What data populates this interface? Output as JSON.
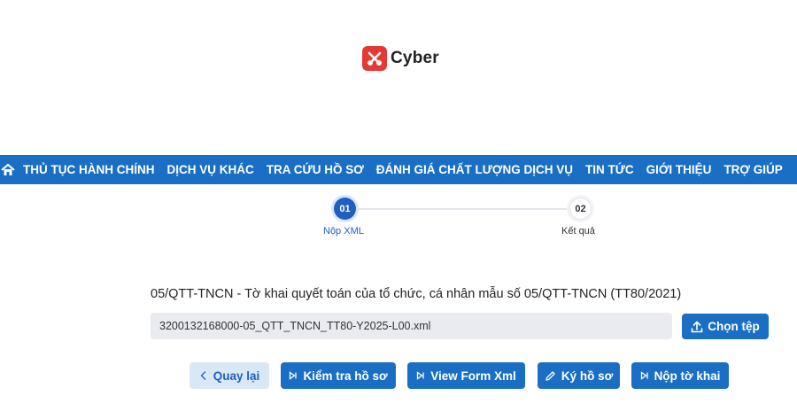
{
  "brand": {
    "name": "Cyber",
    "mark_color": "#e53935"
  },
  "navbar": {
    "home_icon": "home-icon",
    "items": [
      "THỦ TỤC HÀNH CHÍNH",
      "DỊCH VỤ KHÁC",
      "TRA CỨU HỒ SƠ",
      "ĐÁNH GIÁ CHẤT LƯỢNG DỊCH VỤ",
      "TIN TỨC",
      "GIỚI THIỆU",
      "TRỢ GIÚP"
    ],
    "bg_color": "#1a6fc4"
  },
  "stepper": {
    "steps": [
      {
        "number": "01",
        "label": "Nộp XML",
        "state": "active"
      },
      {
        "number": "02",
        "label": "Kết quả",
        "state": "pending"
      }
    ]
  },
  "form": {
    "title": "05/QTT-TNCN - Tờ khai quyết toán của tổ chức, cá nhân mẫu số 05/QTT-TNCN (TT80/2021)",
    "file_value": "3200132168000-05_QTT_TNCN_TT80-Y2025-L00.xml",
    "choose_label": "Chọn tệp"
  },
  "actions": {
    "back": "Quay lại",
    "check": "Kiểm tra hồ sơ",
    "view": "View Form Xml",
    "sign": "Ký hồ sơ",
    "submit": "Nộp tờ khai"
  },
  "colors": {
    "primary": "#1a6fc4",
    "step_active": "#1f5fbf",
    "back_bg": "#d9e8f7"
  }
}
